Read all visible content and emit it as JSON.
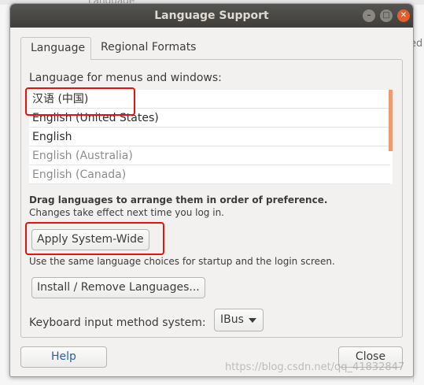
{
  "background": {
    "peek_top": "Language",
    "peek_right": "ed"
  },
  "window": {
    "title": "Language Support",
    "controls": {
      "minimize_icon": "–",
      "maximize_icon": "□",
      "close_icon": "✕"
    }
  },
  "tabs": [
    {
      "label": "Language",
      "active": true
    },
    {
      "label": "Regional Formats",
      "active": false
    }
  ],
  "language_section": {
    "label": "Language for menus and windows:",
    "languages": [
      {
        "label": "汉语 (中国)",
        "muted": false
      },
      {
        "label": "English (United States)",
        "muted": false
      },
      {
        "label": "English",
        "muted": false
      },
      {
        "label": "English (Australia)",
        "muted": true
      },
      {
        "label": "English (Canada)",
        "muted": true
      }
    ],
    "drag_note": "Drag languages to arrange them in order of preference.",
    "changes_note": "Changes take effect next time you log in."
  },
  "apply_button": "Apply System-Wide",
  "use_note": "Use the same language choices for startup and the login screen.",
  "install_button": "Install / Remove Languages...",
  "keyboard": {
    "label": "Keyboard input method system:",
    "selected": "IBus"
  },
  "footer": {
    "help_button": "Help",
    "close_button": "Close"
  },
  "watermark": "https://blog.csdn.net/qq_41832847",
  "colors": {
    "highlight": "#e3140f",
    "titlebar": "#3f3e3b",
    "close_button": "#e85c2b",
    "scroll_indicator": "#ef9b71"
  }
}
